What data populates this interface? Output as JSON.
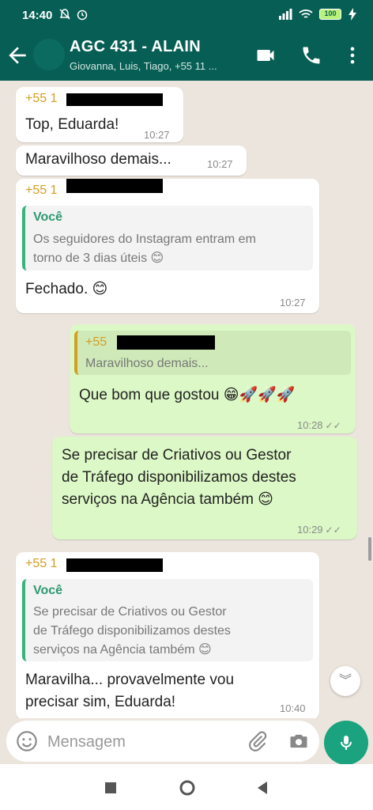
{
  "status": {
    "time": "14:40",
    "battery": "100"
  },
  "header": {
    "title": "AGC 431 - ALAIN",
    "subtitle": "Giovanna, Luis, Tiago, +55 11 ..."
  },
  "messages": {
    "m1": {
      "sender": "+55 1",
      "text": "Top, Eduarda!",
      "time": "10:27"
    },
    "m2": {
      "text": "Maravilhoso demais...",
      "time": "10:27"
    },
    "m3": {
      "sender": "+55 1",
      "quote_name": "Você",
      "quote_text_1": "Os seguidores do Instagram entram em",
      "quote_text_2": "torno de 3 dias úteis 😊",
      "text": "Fechado. 😊",
      "time": "10:27"
    },
    "m4": {
      "quote_sender": "+55",
      "quote_text": "Maravilhoso demais...",
      "text": "Que bom que gostou 😁🚀🚀🚀",
      "time": "10:28"
    },
    "m5": {
      "line_1": "Se precisar de Criativos ou Gestor",
      "line_2": "de Tráfego disponibilizamos destes",
      "line_3": "serviços na Agência também 😊",
      "time": "10:29"
    },
    "m6": {
      "sender": "+55 1",
      "quote_name": "Você",
      "quote_text_1": "Se precisar de Criativos ou Gestor",
      "quote_text_2": "de Tráfego disponibilizamos destes",
      "quote_text_3": "serviços na Agência também 😊",
      "line_1": "Maravilha... provavelmente vou",
      "line_2": "precisar sim, Eduarda!",
      "time": "10:40"
    }
  },
  "input": {
    "placeholder": "Mensagem"
  },
  "colors": {
    "header": "#075e54",
    "outgoing_bubble": "#dcf8c6",
    "incoming_bubble": "#ffffff",
    "sender_name": "#d39e23",
    "mic_button": "#1aa37e"
  },
  "icons": [
    "back-arrow-icon",
    "video-call-icon",
    "phone-icon",
    "more-vert-icon",
    "emoji-icon",
    "attach-icon",
    "camera-icon",
    "mic-icon",
    "double-check-icon",
    "chevron-down-icon",
    "nav-recents-icon",
    "nav-home-icon",
    "nav-back-icon"
  ]
}
